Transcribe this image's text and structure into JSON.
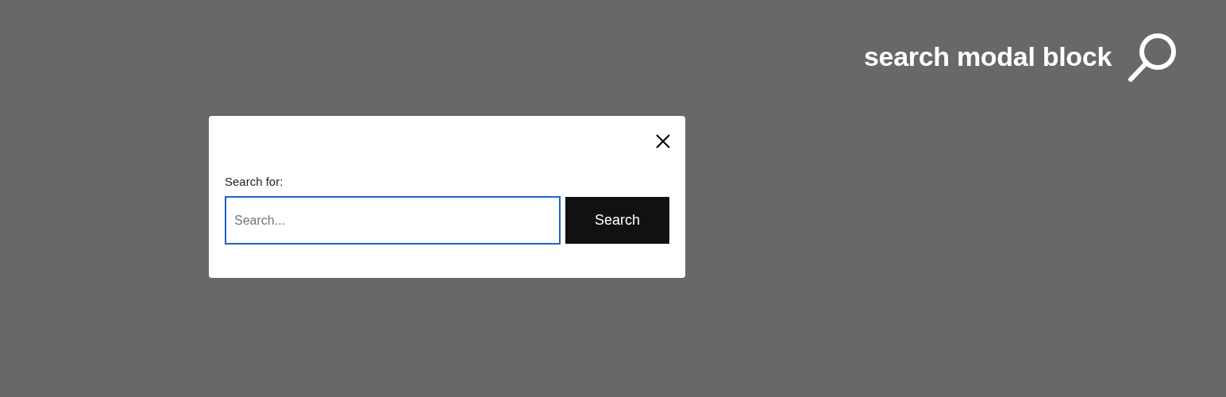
{
  "header": {
    "title": "search modal block"
  },
  "modal": {
    "label": "Search for:",
    "field": {
      "placeholder": "Search...",
      "focused": true
    },
    "submit": "Search"
  }
}
